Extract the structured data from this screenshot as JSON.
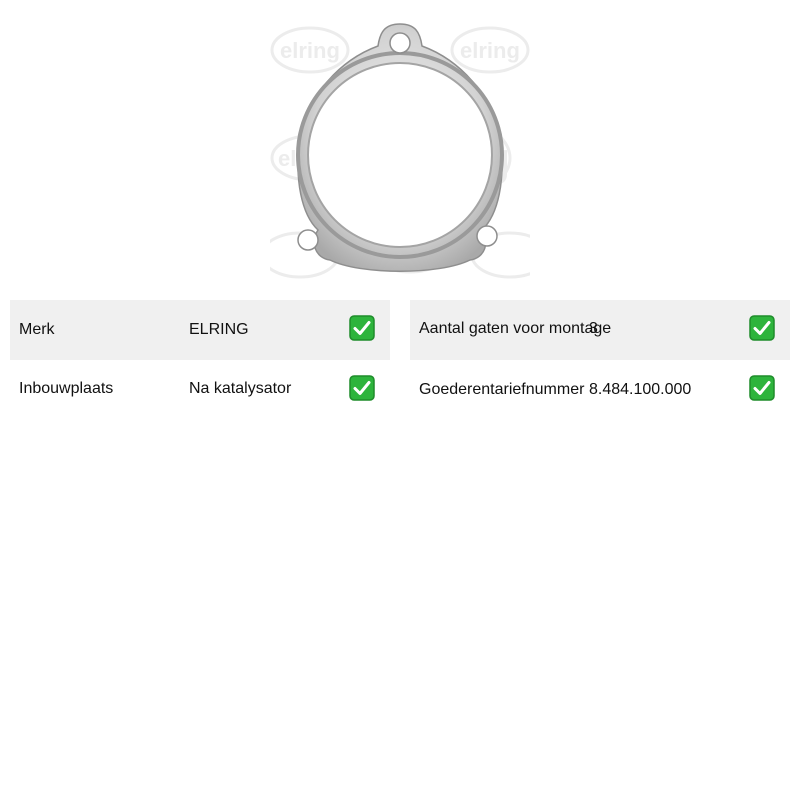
{
  "product": {
    "image_icon": "exhaust-gasket-image",
    "watermark_text": "elring"
  },
  "specs_left": [
    {
      "label": "Merk",
      "value": "ELRING",
      "check_icon": "check-mark-icon"
    },
    {
      "label": "Inbouwplaats",
      "value": "Na katalysator",
      "check_icon": "check-mark-icon"
    }
  ],
  "specs_right": [
    {
      "label": "Aantal gaten voor montage",
      "value": "3",
      "check_icon": "check-mark-icon"
    },
    {
      "label": "Goederentariefnummer",
      "value": "8.484.100.000",
      "check_icon": "check-mark-icon"
    }
  ],
  "colors": {
    "row_shade": "#f0f0f0",
    "check_green": "#2db43c",
    "check_border": "#1e8c2a"
  }
}
